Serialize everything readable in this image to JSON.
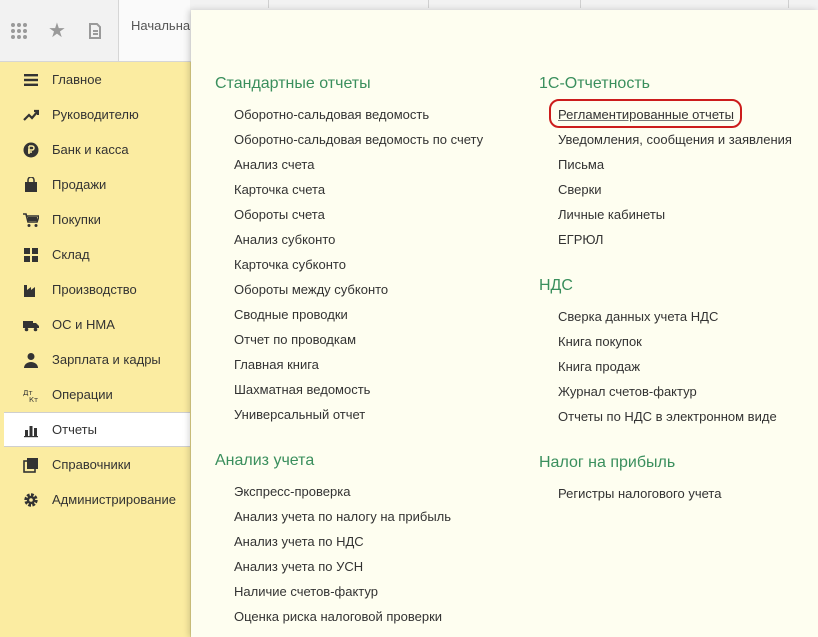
{
  "toolbar": {
    "tab_label": "Начальна"
  },
  "sidebar": {
    "items": [
      {
        "label": "Главное",
        "icon": "menu-lines-icon"
      },
      {
        "label": "Руководителю",
        "icon": "trend-up-icon"
      },
      {
        "label": "Банк и касса",
        "icon": "ruble-coin-icon"
      },
      {
        "label": "Продажи",
        "icon": "shopping-bag-icon"
      },
      {
        "label": "Покупки",
        "icon": "shopping-cart-icon"
      },
      {
        "label": "Склад",
        "icon": "warehouse-grid-icon"
      },
      {
        "label": "Производство",
        "icon": "factory-icon"
      },
      {
        "label": "ОС и НМА",
        "icon": "truck-icon"
      },
      {
        "label": "Зарплата и кадры",
        "icon": "person-icon"
      },
      {
        "label": "Операции",
        "icon": "dt-kt-icon"
      },
      {
        "label": "Отчеты",
        "icon": "bar-chart-icon"
      },
      {
        "label": "Справочники",
        "icon": "books-icon"
      },
      {
        "label": "Администрирование",
        "icon": "gear-icon"
      }
    ],
    "active_index": 10
  },
  "sections": {
    "standard": {
      "title": "Стандартные отчеты",
      "items": [
        "Оборотно-сальдовая ведомость",
        "Оборотно-сальдовая ведомость по счету",
        "Анализ счета",
        "Карточка счета",
        "Обороты счета",
        "Анализ субконто",
        "Карточка субконто",
        "Обороты между субконто",
        "Сводные проводки",
        "Отчет по проводкам",
        "Главная книга",
        "Шахматная ведомость",
        "Универсальный отчет"
      ]
    },
    "analysis": {
      "title": "Анализ учета",
      "items": [
        "Экспресс-проверка",
        "Анализ учета по налогу на прибыль",
        "Анализ учета по НДС",
        "Анализ учета по УСН",
        "Наличие счетов-фактур",
        "Оценка риска налоговой проверки"
      ]
    },
    "reporting": {
      "title": "1С-Отчетность",
      "items": [
        "Регламентированные отчеты",
        "Уведомления, сообщения и заявления",
        "Письма",
        "Сверки",
        "Личные кабинеты",
        "ЕГРЮЛ"
      ]
    },
    "vat": {
      "title": "НДС",
      "items": [
        "Сверка данных учета НДС",
        "Книга покупок",
        "Книга продаж",
        "Журнал счетов-фактур",
        "Отчеты по НДС в электронном виде"
      ]
    },
    "profit_tax": {
      "title": "Налог на прибыль",
      "items": [
        "Регистры налогового учета"
      ]
    }
  },
  "colors": {
    "sidebar_bg": "#fbeca1",
    "section_title": "#3a8f5d",
    "highlight_border": "#cc1c1c"
  }
}
